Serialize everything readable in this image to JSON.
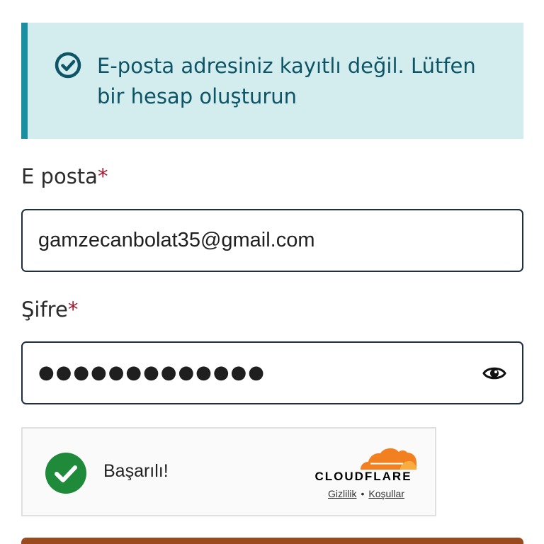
{
  "alert": {
    "message": "E-posta adresiniz kayıtlı değil. Lütfen bir hesap oluşturun",
    "icon": "check-circle-icon",
    "background": "#d3ecee",
    "accent": "#1b8fa2",
    "text_color": "#0d5566"
  },
  "form": {
    "email": {
      "label": "E posta",
      "required_mark": "*",
      "value": "gamzecanbolat35@gmail.com"
    },
    "password": {
      "label": "Şifre",
      "required_mark": "*",
      "masked_value": "●●●●●●●●●●●●●",
      "toggle_icon": "eye-icon"
    }
  },
  "captcha": {
    "status": "Başarılı!",
    "brand": "CLOUDFLARE",
    "privacy_link": "Gizlilik",
    "separator": "•",
    "terms_link": "Koşullar",
    "success_color": "#1e8a3a",
    "brand_color": "#f38020"
  },
  "submit": {
    "color": "#9b4a1e"
  }
}
